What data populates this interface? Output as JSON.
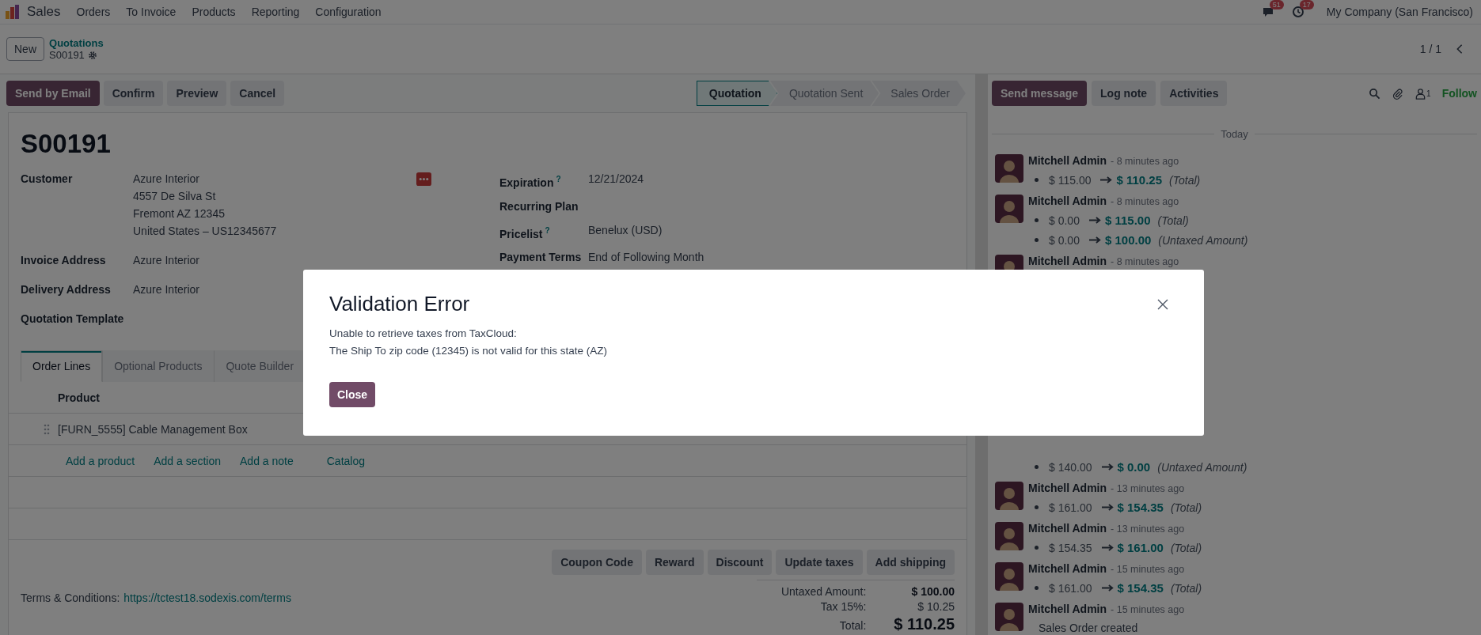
{
  "navbar": {
    "app": "Sales",
    "menus": [
      "Orders",
      "To Invoice",
      "Products",
      "Reporting",
      "Configuration"
    ],
    "message_count": "51",
    "activity_count": "17",
    "company": "My Company (San Francisco)"
  },
  "control_panel": {
    "new_button": "New",
    "breadcrumb": "Quotations",
    "record": "S00191",
    "pager": "1 / 1"
  },
  "actions": [
    {
      "label": "Send by Email",
      "primary": true
    },
    {
      "label": "Confirm",
      "primary": false
    },
    {
      "label": "Preview",
      "primary": false
    },
    {
      "label": "Cancel",
      "primary": false
    }
  ],
  "status_steps": [
    {
      "label": "Quotation",
      "selected": true
    },
    {
      "label": "Quotation Sent",
      "selected": false
    },
    {
      "label": "Sales Order",
      "selected": false
    }
  ],
  "form": {
    "title": "S00191",
    "left_fields": [
      {
        "label": "Customer",
        "lines": [
          "Azure Interior",
          "4557 De Silva St",
          "Fremont AZ 12345",
          "United States – US12345677"
        ]
      },
      {
        "label": "Invoice Address",
        "lines": [
          "Azure Interior"
        ]
      },
      {
        "label": "Delivery Address",
        "lines": [
          "Azure Interior"
        ]
      },
      {
        "label": "Quotation Template"
      }
    ],
    "right_fields": [
      {
        "label": "Expiration",
        "help": "?",
        "value": "12/21/2024"
      },
      {
        "label": "Recurring Plan"
      },
      {
        "label": "Pricelist",
        "help": "?",
        "value": "Benelux (USD)"
      },
      {
        "label": "Payment Terms",
        "value": "End of Following Month"
      }
    ],
    "tabs": [
      {
        "label": "Order Lines",
        "selected": true
      },
      {
        "label": "Optional Products",
        "selected": false
      },
      {
        "label": "Quote Builder",
        "selected": false
      }
    ],
    "lines_table": {
      "columns": [
        "Product"
      ],
      "rows": [
        "[FURN_5555] Cable Management Box"
      ],
      "add_links": [
        "Add a product",
        "Add a section",
        "Add a note"
      ],
      "catalog": "Catalog"
    },
    "buttons": [
      "Coupon Code",
      "Reward",
      "Discount",
      "Update taxes",
      "Add shipping"
    ],
    "terms": {
      "label": "Terms & Conditions:",
      "link": "https://tctest18.sodexis.com/terms"
    },
    "totals": [
      {
        "label": "Untaxed Amount:",
        "value": "$ 100.00",
        "kind": "bold"
      },
      {
        "label": "Tax 15%:",
        "value": "$ 10.25",
        "kind": "plain"
      },
      {
        "label": "Total:",
        "value": "$ 110.25",
        "kind": "grand"
      }
    ]
  },
  "chatter": {
    "buttons": [
      {
        "label": "Send message",
        "primary": true
      },
      {
        "label": "Log note",
        "primary": false
      },
      {
        "label": "Activities",
        "primary": false
      }
    ],
    "follower_count": "1",
    "follow": "Follow",
    "date_separator": "Today",
    "messages": [
      {
        "author": "Mitchell Admin",
        "time": "- 8 minutes ago",
        "changes": [
          {
            "old": "$ 115.00",
            "new": "$ 110.25",
            "field": "(Total)"
          }
        ]
      },
      {
        "author": "Mitchell Admin",
        "time": "- 8 minutes ago",
        "changes": [
          {
            "old": "$ 0.00",
            "new": "$ 115.00",
            "field": "(Total)"
          },
          {
            "old": "$ 0.00",
            "new": "$ 100.00",
            "field": "(Untaxed Amount)"
          }
        ]
      },
      {
        "author": "Mitchell Admin",
        "time": "- 8 minutes ago"
      },
      {
        "changes": [
          {
            "old": "$ 140.00",
            "new": "$ 0.00",
            "field": "(Untaxed Amount)"
          }
        ]
      },
      {
        "author": "Mitchell Admin",
        "time": "- 13 minutes ago",
        "changes": [
          {
            "old": "$ 161.00",
            "new": "$ 154.35",
            "field": "(Total)"
          }
        ]
      },
      {
        "author": "Mitchell Admin",
        "time": "- 13 minutes ago",
        "changes": [
          {
            "old": "$ 154.35",
            "new": "$ 161.00",
            "field": "(Total)"
          }
        ]
      },
      {
        "author": "Mitchell Admin",
        "time": "- 15 minutes ago",
        "changes": [
          {
            "old": "$ 161.00",
            "new": "$ 154.35",
            "field": "(Total)"
          }
        ]
      },
      {
        "author": "Mitchell Admin",
        "time": "- 15 minutes ago",
        "body": "Sales Order created"
      }
    ]
  },
  "dialog": {
    "title": "Validation Error",
    "lines": [
      "Unable to retrieve taxes from TaxCloud:",
      "The Ship To zip code (12345) is not valid for this state (AZ)"
    ],
    "button": "Close"
  }
}
